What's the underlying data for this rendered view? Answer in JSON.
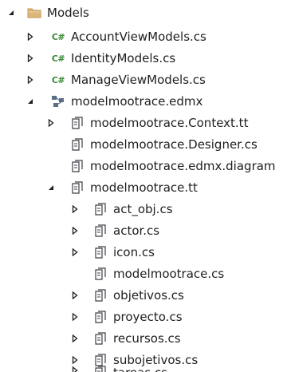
{
  "explorer": {
    "folder": {
      "label": "Models",
      "icon": "folder-icon"
    },
    "cs_files": [
      {
        "label": "AccountViewModels.cs",
        "icon": "csharp-file-icon"
      },
      {
        "label": "IdentityModels.cs",
        "icon": "csharp-file-icon"
      },
      {
        "label": "ManageViewModels.cs",
        "icon": "csharp-file-icon"
      }
    ],
    "edmx": {
      "label": "modelmootrace.edmx",
      "icon": "edmx-model-icon",
      "children": [
        {
          "label": "modelmootrace.Context.tt",
          "icon": "text-template-icon"
        },
        {
          "label": "modelmootrace.Designer.cs",
          "icon": "text-template-icon"
        },
        {
          "label": "modelmootrace.edmx.diagram",
          "icon": "text-template-icon"
        }
      ]
    },
    "tt": {
      "label": "modelmootrace.tt",
      "icon": "text-template-icon",
      "children": [
        {
          "label": "act_obj.cs",
          "icon": "generated-file-icon"
        },
        {
          "label": "actor.cs",
          "icon": "generated-file-icon"
        },
        {
          "label": "icon.cs",
          "icon": "generated-file-icon"
        },
        {
          "label": "modelmootrace.cs",
          "icon": "generated-file-icon"
        },
        {
          "label": "objetivos.cs",
          "icon": "generated-file-icon"
        },
        {
          "label": "proyecto.cs",
          "icon": "generated-file-icon"
        },
        {
          "label": "recursos.cs",
          "icon": "generated-file-icon"
        },
        {
          "label": "subojetivos.cs",
          "icon": "generated-file-icon"
        },
        {
          "label": "tareas.cs",
          "icon": "generated-file-icon"
        }
      ]
    },
    "cs_badge": "C#"
  }
}
